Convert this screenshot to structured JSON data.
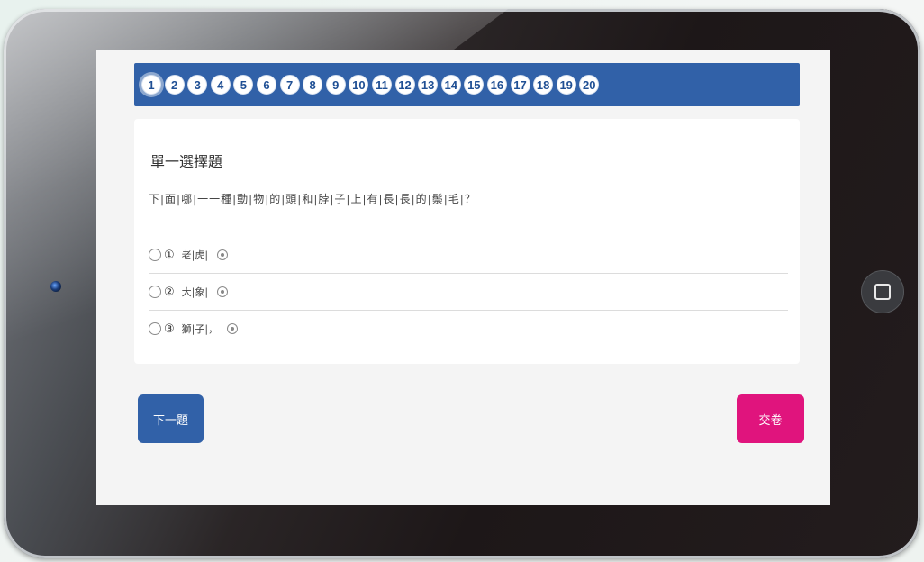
{
  "question_nav": {
    "numbers": [
      "1",
      "2",
      "3",
      "4",
      "5",
      "6",
      "7",
      "8",
      "9",
      "10",
      "11",
      "12",
      "13",
      "14",
      "15",
      "16",
      "17",
      "18",
      "19",
      "20"
    ],
    "active": "1"
  },
  "question": {
    "type_label": "單一選擇題",
    "text": "下|面|哪|一一種|動|物|的|頭|和|脖|子|上|有|長|長|的|鬃|毛|？",
    "options": [
      {
        "num": "①",
        "text": "老|虎|"
      },
      {
        "num": "②",
        "text": "大|象|"
      },
      {
        "num": "③",
        "text": "獅|子|，"
      }
    ]
  },
  "buttons": {
    "next_label": "下一題",
    "submit_label": "交卷"
  },
  "colors": {
    "nav_blue": "#3161a8",
    "submit_pink": "#e0147d"
  },
  "icons": {
    "option_audio": "audio-icon",
    "home": "home-button-icon"
  }
}
